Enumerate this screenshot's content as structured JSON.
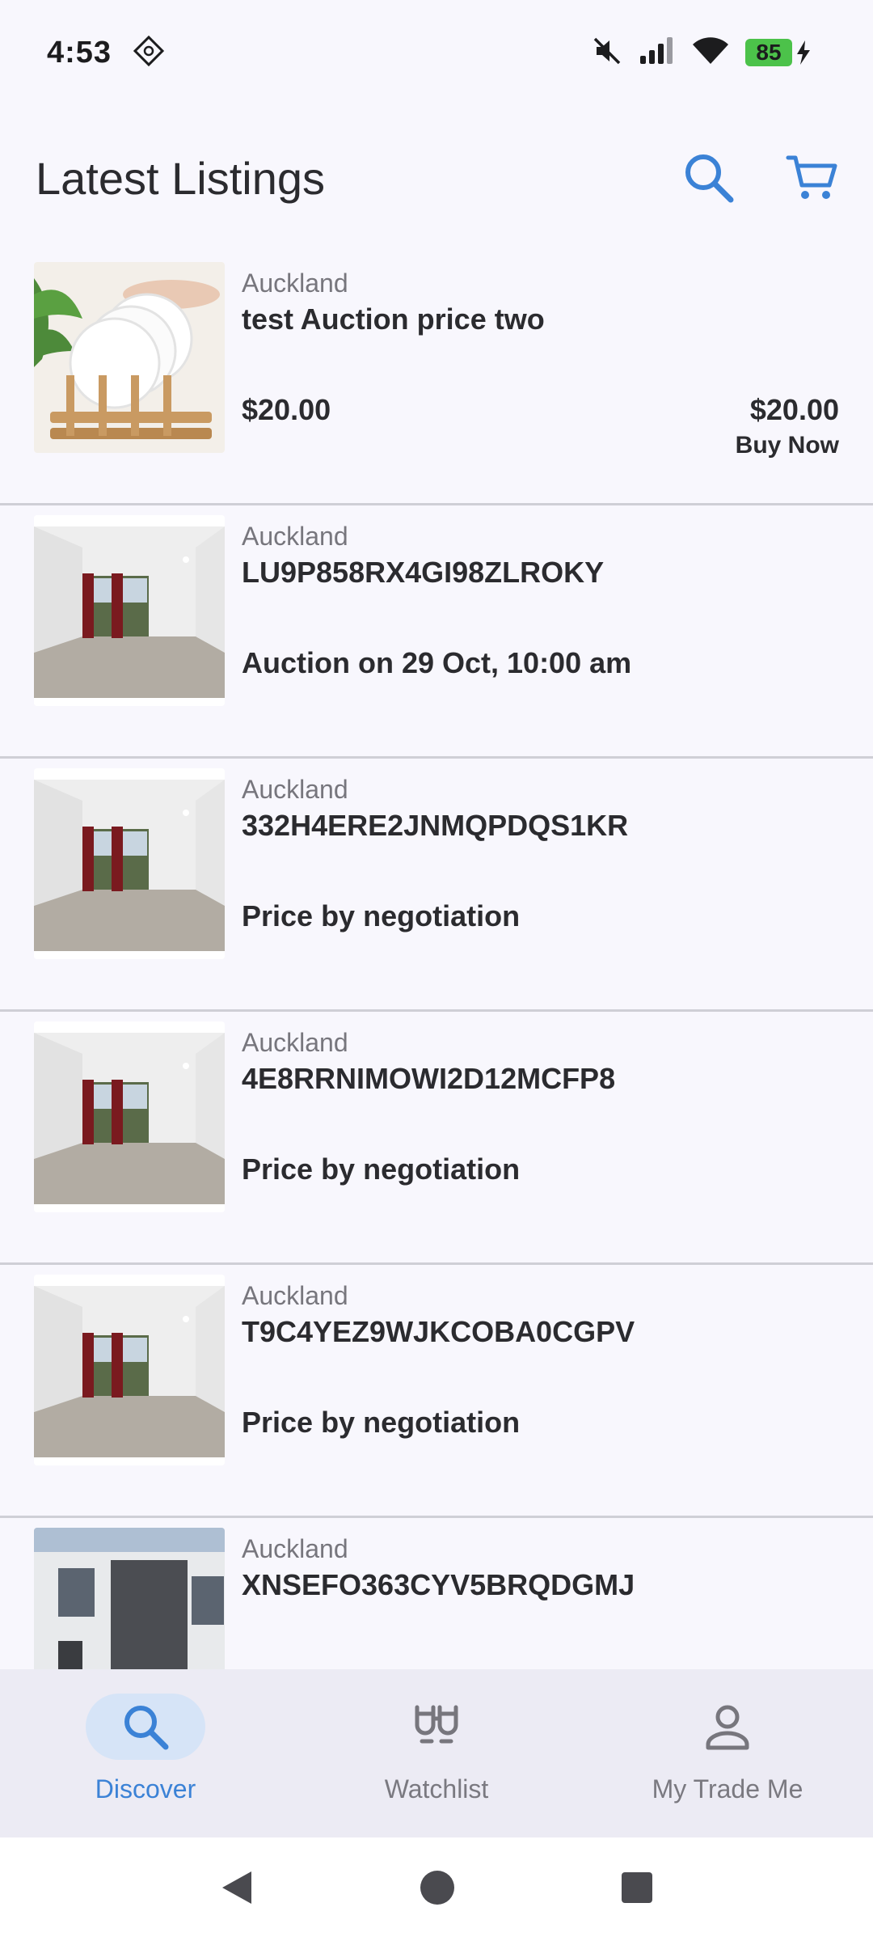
{
  "status_bar": {
    "time": "4:53",
    "battery_level": "85",
    "icons": [
      "nfc-icon",
      "mute-icon",
      "signal-icon",
      "wifi-icon",
      "battery-icon",
      "charging-icon"
    ]
  },
  "header": {
    "title": "Latest Listings",
    "actions": [
      "search-icon",
      "cart-icon"
    ],
    "accent_color": "#3b82d6"
  },
  "listings": [
    {
      "location": "Auckland",
      "title": "test Auction price two",
      "price_left": "$20.00",
      "price_right": "$20.00",
      "price_right_label": "Buy Now",
      "image": "dish-rack"
    },
    {
      "location": "Auckland",
      "title": "LU9P858RX4GI98ZLROKY",
      "price_left": "Auction on 29 Oct, 10:00 am",
      "image": "empty-room"
    },
    {
      "location": "Auckland",
      "title": "332H4ERE2JNMQPDQS1KR",
      "price_left": "Price by negotiation",
      "image": "empty-room"
    },
    {
      "location": "Auckland",
      "title": "4E8RRNIMOWI2D12MCFP8",
      "price_left": "Price by negotiation",
      "image": "empty-room"
    },
    {
      "location": "Auckland",
      "title": "T9C4YEZ9WJKCOBA0CGPV",
      "price_left": "Price by negotiation",
      "image": "empty-room"
    },
    {
      "location": "Auckland",
      "title": "XNSEFO363CYV5BRQDGMJ",
      "image": "building"
    }
  ],
  "bottom_nav": {
    "items": [
      {
        "label": "Discover",
        "icon": "search-icon",
        "active": true
      },
      {
        "label": "Watchlist",
        "icon": "binoculars-icon",
        "active": false
      },
      {
        "label": "My Trade Me",
        "icon": "person-icon",
        "active": false
      }
    ]
  },
  "system_nav": [
    "back-icon",
    "home-icon",
    "recents-icon"
  ]
}
